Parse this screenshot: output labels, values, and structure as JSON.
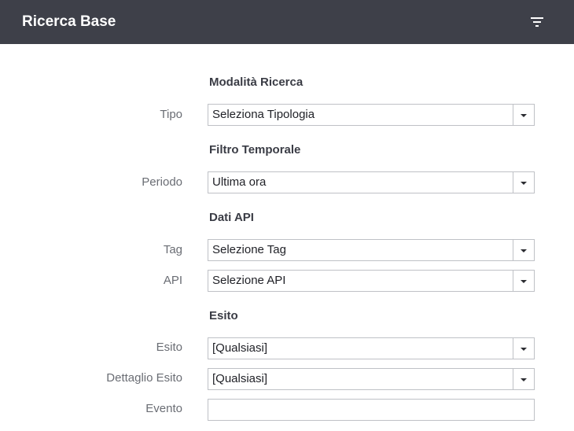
{
  "header": {
    "title": "Ricerca Base",
    "filter_icon": "filter-list-icon"
  },
  "sections": {
    "modalita": {
      "title": "Modalità Ricerca"
    },
    "filtro": {
      "title": "Filtro Temporale"
    },
    "dati_api": {
      "title": "Dati API"
    },
    "esito": {
      "title": "Esito"
    }
  },
  "fields": {
    "tipo": {
      "label": "Tipo",
      "value": "Seleziona Tipologia"
    },
    "periodo": {
      "label": "Periodo",
      "value": "Ultima ora"
    },
    "tag": {
      "label": "Tag",
      "value": "Selezione Tag"
    },
    "api": {
      "label": "API",
      "value": "Selezione API"
    },
    "esito": {
      "label": "Esito",
      "value": "[Qualsiasi]"
    },
    "dettaglio_esito": {
      "label": "Dettaglio Esito",
      "value": "[Qualsiasi]"
    },
    "evento": {
      "label": "Evento",
      "value": "",
      "placeholder": ""
    }
  },
  "colors": {
    "header_bg": "#3e4049",
    "border": "#bfc1c6",
    "label_text": "#6a6d74",
    "section_text": "#3a3c45"
  }
}
